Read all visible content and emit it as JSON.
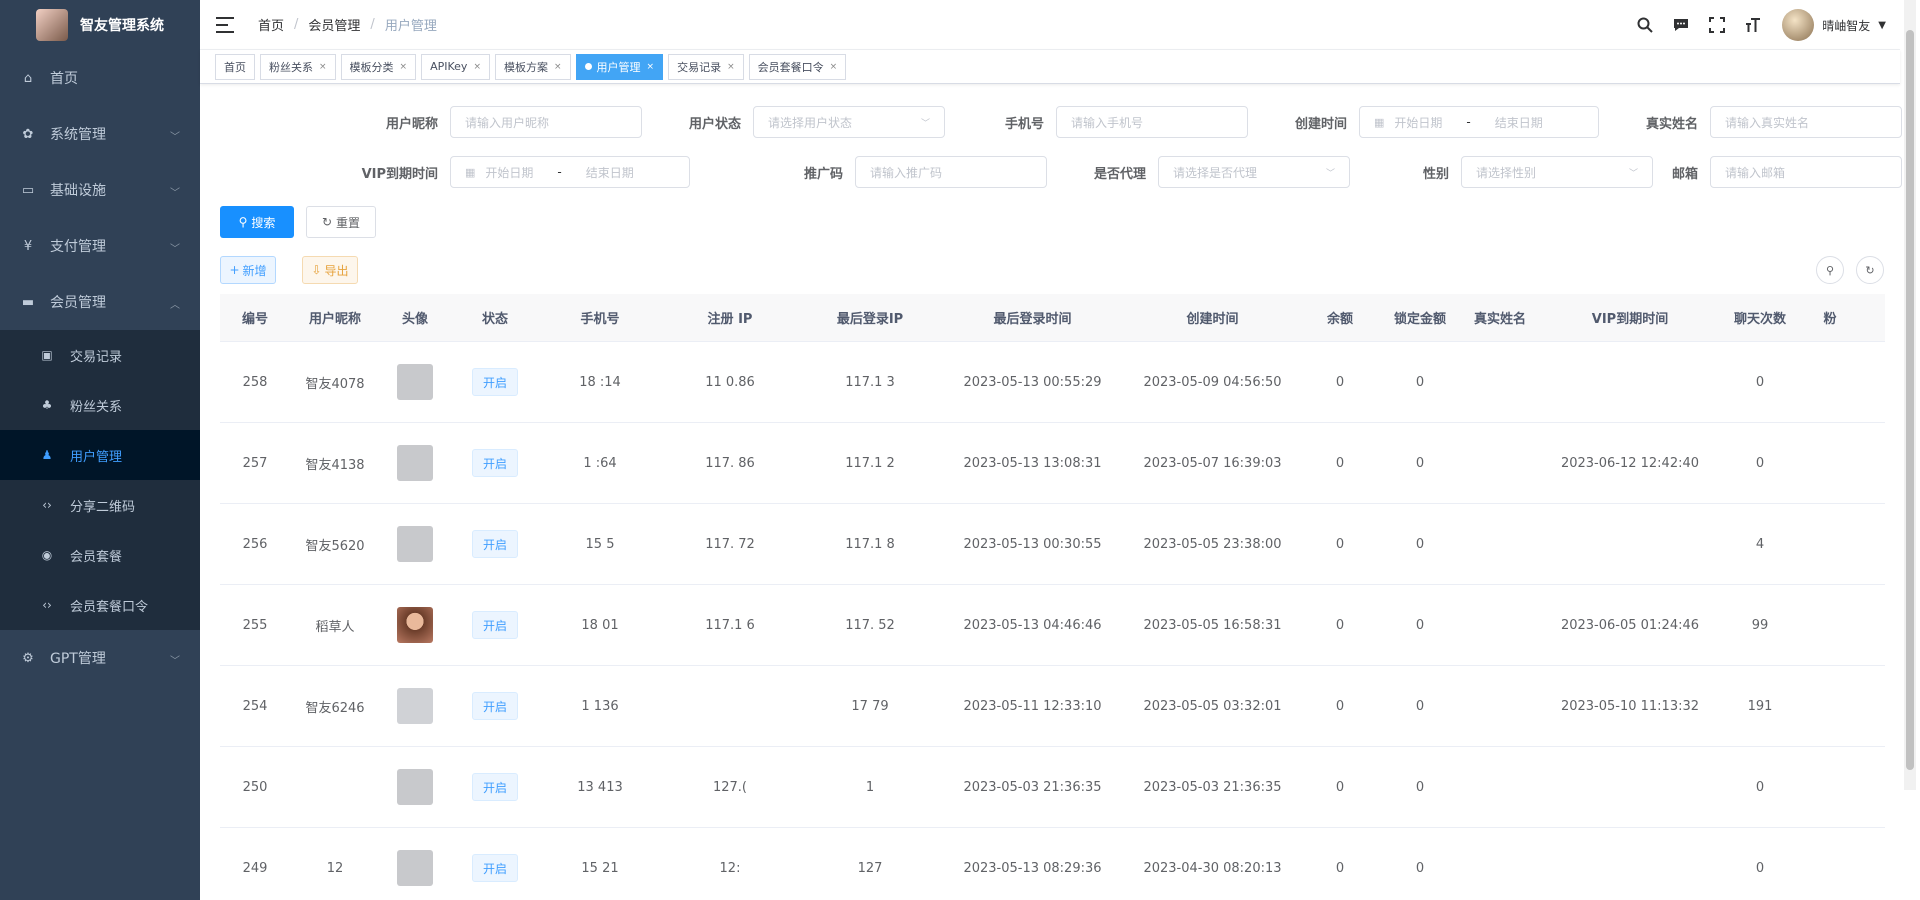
{
  "app": {
    "title": "智友管理系统"
  },
  "sidebar": {
    "items": [
      {
        "label": "首页",
        "icon": "dashboard-icon",
        "glyph": "⌂"
      },
      {
        "label": "系统管理",
        "icon": "system-icon",
        "glyph": "✿"
      },
      {
        "label": "基础设施",
        "icon": "monitor-icon",
        "glyph": "▭"
      },
      {
        "label": "支付管理",
        "icon": "yen-icon",
        "glyph": "¥"
      },
      {
        "label": "会员管理",
        "icon": "member-icon",
        "glyph": "▬"
      }
    ],
    "submenu": [
      {
        "label": "交易记录",
        "icon": "record-icon",
        "glyph": "▣"
      },
      {
        "label": "粉丝关系",
        "icon": "peoples-icon",
        "glyph": "♣"
      },
      {
        "label": "用户管理",
        "icon": "user-icon",
        "glyph": "♟"
      },
      {
        "label": "分享二维码",
        "icon": "code-icon",
        "glyph": "‹›"
      },
      {
        "label": "会员套餐",
        "icon": "radio-icon",
        "glyph": "◉"
      },
      {
        "label": "会员套餐口令",
        "icon": "code-icon",
        "glyph": "‹›"
      }
    ],
    "gpt": {
      "label": "GPT管理",
      "icon": "gear-icon",
      "glyph": "⚙"
    }
  },
  "header": {
    "breadcrumb": [
      "首页",
      "会员管理",
      "用户管理"
    ],
    "username": "晴岫智友"
  },
  "tags": [
    {
      "label": "首页",
      "closable": false
    },
    {
      "label": "粉丝关系",
      "closable": true
    },
    {
      "label": "模板分类",
      "closable": true
    },
    {
      "label": "APIKey",
      "closable": true
    },
    {
      "label": "模板方案",
      "closable": true
    },
    {
      "label": "用户管理",
      "closable": true,
      "active": true
    },
    {
      "label": "交易记录",
      "closable": true
    },
    {
      "label": "会员套餐口令",
      "closable": true
    }
  ],
  "filters": {
    "nickname": {
      "label": "用户昵称",
      "placeholder": "请输入用户昵称"
    },
    "status": {
      "label": "用户状态",
      "placeholder": "请选择用户状态"
    },
    "phone": {
      "label": "手机号",
      "placeholder": "请输入手机号"
    },
    "created": {
      "label": "创建时间",
      "start": "开始日期",
      "end": "结束日期"
    },
    "realname": {
      "label": "真实姓名",
      "placeholder": "请输入真实姓名"
    },
    "vip": {
      "label": "VIP到期时间",
      "start": "开始日期",
      "end": "结束日期"
    },
    "promo": {
      "label": "推广码",
      "placeholder": "请输入推广码"
    },
    "agent": {
      "label": "是否代理",
      "placeholder": "请选择是否代理"
    },
    "gender": {
      "label": "性别",
      "placeholder": "请选择性别"
    },
    "email": {
      "label": "邮箱",
      "placeholder": "请输入邮箱"
    }
  },
  "buttons": {
    "search": "搜索",
    "reset": "重置",
    "add": "新增",
    "export": "导出"
  },
  "table": {
    "headers": [
      "编号",
      "用户昵称",
      "头像",
      "状态",
      "手机号",
      "注册 IP",
      "最后登录IP",
      "最后登录时间",
      "创建时间",
      "余额",
      "锁定金额",
      "真实姓名",
      "VIP到期时间",
      "聊天次数",
      "粉"
    ],
    "rows": [
      {
        "id": "258",
        "nick": "智友4078",
        "avatar": "blank",
        "status": "开启",
        "phone": "18  :14",
        "regip": "11   0.86",
        "lastip": "117.1    3",
        "lastlogin": "2023-05-13 00:55:29",
        "created": "2023-05-09 04:56:50",
        "balance": "0",
        "locked": "0",
        "realname": "",
        "vip": "",
        "chats": "0"
      },
      {
        "id": "257",
        "nick": "智友4138",
        "avatar": "blank",
        "status": "开启",
        "phone": "1   :64",
        "regip": "117.   86",
        "lastip": "117.1    2",
        "lastlogin": "2023-05-13 13:08:31",
        "created": "2023-05-07 16:39:03",
        "balance": "0",
        "locked": "0",
        "realname": "",
        "vip": "2023-06-12 12:42:40",
        "chats": "0"
      },
      {
        "id": "256",
        "nick": "智友5620",
        "avatar": "blank",
        "status": "开启",
        "phone": "15   5",
        "regip": "117.   72",
        "lastip": "117.1   8",
        "lastlogin": "2023-05-13 00:30:55",
        "created": "2023-05-05 23:38:00",
        "balance": "0",
        "locked": "0",
        "realname": "",
        "vip": "",
        "chats": "4"
      },
      {
        "id": "255",
        "nick": "稻草人",
        "avatar": "img",
        "status": "开启",
        "phone": "18   01",
        "regip": "117.1   6",
        "lastip": "117.   52",
        "lastlogin": "2023-05-13 04:46:46",
        "created": "2023-05-05 16:58:31",
        "balance": "0",
        "locked": "0",
        "realname": "",
        "vip": "2023-06-05 01:24:46",
        "chats": "99"
      },
      {
        "id": "254",
        "nick": "智友6246",
        "avatar": "default",
        "status": "开启",
        "phone": "1   136",
        "regip": "",
        "lastip": "17    79",
        "lastlogin": "2023-05-11 12:33:10",
        "created": "2023-05-05 03:32:01",
        "balance": "0",
        "locked": "0",
        "realname": "",
        "vip": "2023-05-10 11:13:32",
        "chats": "191"
      },
      {
        "id": "250",
        "nick": "",
        "avatar": "blank",
        "status": "开启",
        "phone": "13   413",
        "regip": "127.(",
        "lastip": "1",
        "lastlogin": "2023-05-03 21:36:35",
        "created": "2023-05-03 21:36:35",
        "balance": "0",
        "locked": "0",
        "realname": "",
        "vip": "",
        "chats": "0"
      },
      {
        "id": "249",
        "nick": "12",
        "avatar": "blank",
        "status": "开启",
        "phone": "15   21",
        "regip": "12:",
        "lastip": "127",
        "lastlogin": "2023-05-13 08:29:36",
        "created": "2023-04-30 08:20:13",
        "balance": "0",
        "locked": "0",
        "realname": "",
        "vip": "",
        "chats": "0"
      }
    ]
  },
  "colors": {
    "sidebar": "#304156",
    "primary": "#1890ff",
    "active_tag": "#42a5f5"
  }
}
